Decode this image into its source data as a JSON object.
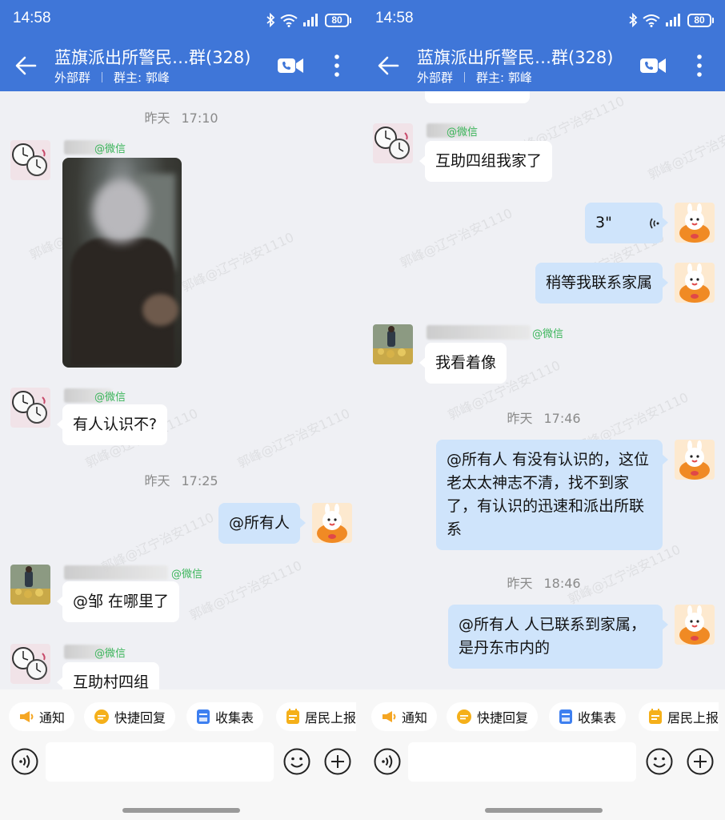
{
  "status_bar": {
    "time": "14:58",
    "battery": "80"
  },
  "header": {
    "title": "蓝旗派出所警民…群(328)",
    "group_type": "外部群",
    "owner_label": "群主: 郭峰"
  },
  "watermark": "郭峰@辽宁治安1110",
  "left_chat": {
    "timestamps": [
      {
        "day": "昨天",
        "time": "17:10"
      },
      {
        "day": "昨天",
        "time": "17:25"
      }
    ],
    "sender_suffix": [
      "@微信",
      "@微信",
      "@微信",
      "@微信"
    ],
    "messages": [
      {
        "text": "有人认识不?"
      },
      {
        "text": "@所有人"
      },
      {
        "text": "@邹 在哪里了"
      },
      {
        "text": "互助村四组"
      }
    ]
  },
  "right_chat": {
    "timestamps": [
      {
        "day": "昨天",
        "time": "17:46"
      },
      {
        "day": "昨天",
        "time": "18:46"
      }
    ],
    "sender_suffix": [
      "@微信",
      "@微信"
    ],
    "messages": [
      {
        "text": "互助四组我家了"
      },
      {
        "text": "3\""
      },
      {
        "text": "稍等我联系家属"
      },
      {
        "text": "我看着像"
      },
      {
        "text": "@所有人 有没有认识的，这位老太太神志不清，找不到家了，有认识的迅速和派出所联系"
      },
      {
        "text": "@所有人  人已联系到家属，是丹东市内的"
      }
    ]
  },
  "quick_actions": [
    "通知",
    "快捷回复",
    "收集表",
    "居民上报"
  ],
  "input": {
    "placeholder": ""
  },
  "colors": {
    "header_bg": "#3f76d8",
    "chat_bg": "#eff0f4",
    "my_bubble": "#cfe4fb",
    "other_bubble": "#ffffff"
  },
  "icons": [
    "back-arrow-icon",
    "video-call-icon",
    "more-vertical-icon",
    "bluetooth-icon",
    "wifi-icon",
    "signal-icon",
    "battery-icon",
    "voice-input-icon",
    "emoji-icon",
    "plus-icon",
    "megaphone-icon",
    "quick-reply-icon",
    "form-icon",
    "report-icon"
  ]
}
